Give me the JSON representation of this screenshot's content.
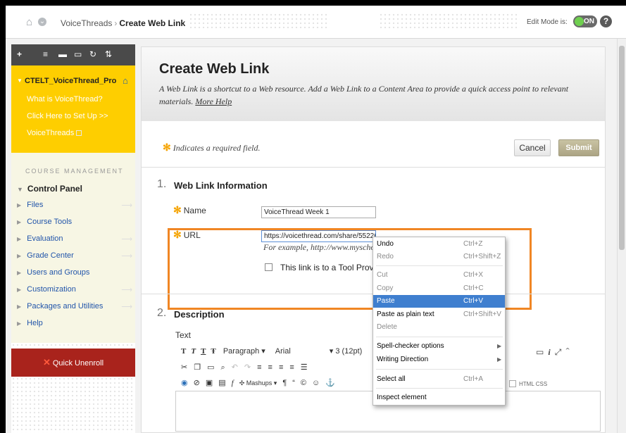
{
  "topbar": {
    "breadcrumb": [
      "VoiceThreads",
      "Create Web Link"
    ],
    "edit_mode_label": "Edit Mode is:",
    "edit_mode_value": "ON",
    "help": "?"
  },
  "sidebar": {
    "tools": [
      "+",
      "≡",
      "▬",
      "▭",
      "↻",
      "⇅"
    ],
    "course_title": "CTELT_VoiceThread_Pro",
    "course_items": [
      "What is VoiceThread?",
      "Click Here to Set Up >>",
      "VoiceThreads"
    ],
    "course_management_heading": "COURSE MANAGEMENT",
    "control_panel": "Control Panel",
    "control_items": [
      "Files",
      "Course Tools",
      "Evaluation",
      "Grade Center",
      "Users and Groups",
      "Customization",
      "Packages and Utilities",
      "Help"
    ],
    "unenroll": "Quick Unenroll"
  },
  "page": {
    "title": "Create Web Link",
    "description": "A Web Link is a shortcut to a Web resource. Add a Web Link to a Content Area to provide a quick access point to relevant materials.",
    "more_help": "More Help",
    "required_note": "Indicates a required field.",
    "cancel": "Cancel",
    "submit": "Submit"
  },
  "section1": {
    "number": "1.",
    "title": "Web Link Information",
    "name_label": "Name",
    "name_value": "VoiceThread Week 1",
    "url_label": "URL",
    "url_value": "https://voicethread.com/share/5522668/",
    "url_example": "For example, http://www.myschool.edu/",
    "tool_provider": "This link is to a Tool Provider."
  },
  "section2": {
    "number": "2.",
    "title": "Description",
    "text_label": "Text",
    "toolbar1": [
      "T",
      "T",
      "T",
      "Ŧ"
    ],
    "paragraph": "Paragraph",
    "font": "Arial",
    "size": "3 (12pt)",
    "mashups": "Mashups",
    "html": "HTML",
    "css": "CSS"
  },
  "context_menu": {
    "groups": [
      [
        {
          "label": "Undo",
          "shortcut": "Ctrl+Z",
          "disabled": false
        },
        {
          "label": "Redo",
          "shortcut": "Ctrl+Shift+Z",
          "disabled": true
        }
      ],
      [
        {
          "label": "Cut",
          "shortcut": "Ctrl+X",
          "disabled": true
        },
        {
          "label": "Copy",
          "shortcut": "Ctrl+C",
          "disabled": true
        },
        {
          "label": "Paste",
          "shortcut": "Ctrl+V",
          "disabled": false,
          "highlighted": true
        },
        {
          "label": "Paste as plain text",
          "shortcut": "Ctrl+Shift+V",
          "disabled": false
        },
        {
          "label": "Delete",
          "shortcut": "",
          "disabled": true
        }
      ],
      [
        {
          "label": "Spell-checker options",
          "submenu": true
        },
        {
          "label": "Writing Direction",
          "submenu": true
        }
      ],
      [
        {
          "label": "Select all",
          "shortcut": "Ctrl+A",
          "disabled": false
        }
      ],
      [
        {
          "label": "Inspect element",
          "shortcut": "",
          "disabled": false
        }
      ]
    ]
  },
  "colors": {
    "course_menu": "#fece00",
    "accent_required": "#f5a300",
    "highlight_box": "#f08624",
    "menu_highlight": "#3f7fcf",
    "unenroll": "#a9231c"
  }
}
